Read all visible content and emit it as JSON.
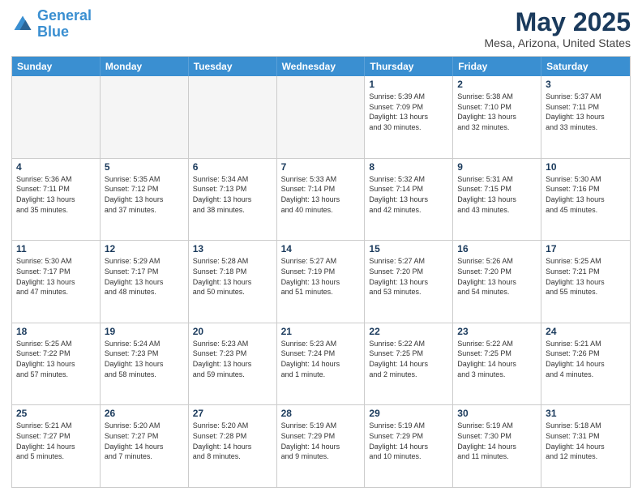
{
  "header": {
    "logo_line1": "General",
    "logo_line2": "Blue",
    "title": "May 2025",
    "subtitle": "Mesa, Arizona, United States"
  },
  "days_of_week": [
    "Sunday",
    "Monday",
    "Tuesday",
    "Wednesday",
    "Thursday",
    "Friday",
    "Saturday"
  ],
  "weeks": [
    [
      {
        "num": "",
        "info": ""
      },
      {
        "num": "",
        "info": ""
      },
      {
        "num": "",
        "info": ""
      },
      {
        "num": "",
        "info": ""
      },
      {
        "num": "1",
        "info": "Sunrise: 5:39 AM\nSunset: 7:09 PM\nDaylight: 13 hours\nand 30 minutes."
      },
      {
        "num": "2",
        "info": "Sunrise: 5:38 AM\nSunset: 7:10 PM\nDaylight: 13 hours\nand 32 minutes."
      },
      {
        "num": "3",
        "info": "Sunrise: 5:37 AM\nSunset: 7:11 PM\nDaylight: 13 hours\nand 33 minutes."
      }
    ],
    [
      {
        "num": "4",
        "info": "Sunrise: 5:36 AM\nSunset: 7:11 PM\nDaylight: 13 hours\nand 35 minutes."
      },
      {
        "num": "5",
        "info": "Sunrise: 5:35 AM\nSunset: 7:12 PM\nDaylight: 13 hours\nand 37 minutes."
      },
      {
        "num": "6",
        "info": "Sunrise: 5:34 AM\nSunset: 7:13 PM\nDaylight: 13 hours\nand 38 minutes."
      },
      {
        "num": "7",
        "info": "Sunrise: 5:33 AM\nSunset: 7:14 PM\nDaylight: 13 hours\nand 40 minutes."
      },
      {
        "num": "8",
        "info": "Sunrise: 5:32 AM\nSunset: 7:14 PM\nDaylight: 13 hours\nand 42 minutes."
      },
      {
        "num": "9",
        "info": "Sunrise: 5:31 AM\nSunset: 7:15 PM\nDaylight: 13 hours\nand 43 minutes."
      },
      {
        "num": "10",
        "info": "Sunrise: 5:30 AM\nSunset: 7:16 PM\nDaylight: 13 hours\nand 45 minutes."
      }
    ],
    [
      {
        "num": "11",
        "info": "Sunrise: 5:30 AM\nSunset: 7:17 PM\nDaylight: 13 hours\nand 47 minutes."
      },
      {
        "num": "12",
        "info": "Sunrise: 5:29 AM\nSunset: 7:17 PM\nDaylight: 13 hours\nand 48 minutes."
      },
      {
        "num": "13",
        "info": "Sunrise: 5:28 AM\nSunset: 7:18 PM\nDaylight: 13 hours\nand 50 minutes."
      },
      {
        "num": "14",
        "info": "Sunrise: 5:27 AM\nSunset: 7:19 PM\nDaylight: 13 hours\nand 51 minutes."
      },
      {
        "num": "15",
        "info": "Sunrise: 5:27 AM\nSunset: 7:20 PM\nDaylight: 13 hours\nand 53 minutes."
      },
      {
        "num": "16",
        "info": "Sunrise: 5:26 AM\nSunset: 7:20 PM\nDaylight: 13 hours\nand 54 minutes."
      },
      {
        "num": "17",
        "info": "Sunrise: 5:25 AM\nSunset: 7:21 PM\nDaylight: 13 hours\nand 55 minutes."
      }
    ],
    [
      {
        "num": "18",
        "info": "Sunrise: 5:25 AM\nSunset: 7:22 PM\nDaylight: 13 hours\nand 57 minutes."
      },
      {
        "num": "19",
        "info": "Sunrise: 5:24 AM\nSunset: 7:23 PM\nDaylight: 13 hours\nand 58 minutes."
      },
      {
        "num": "20",
        "info": "Sunrise: 5:23 AM\nSunset: 7:23 PM\nDaylight: 13 hours\nand 59 minutes."
      },
      {
        "num": "21",
        "info": "Sunrise: 5:23 AM\nSunset: 7:24 PM\nDaylight: 14 hours\nand 1 minute."
      },
      {
        "num": "22",
        "info": "Sunrise: 5:22 AM\nSunset: 7:25 PM\nDaylight: 14 hours\nand 2 minutes."
      },
      {
        "num": "23",
        "info": "Sunrise: 5:22 AM\nSunset: 7:25 PM\nDaylight: 14 hours\nand 3 minutes."
      },
      {
        "num": "24",
        "info": "Sunrise: 5:21 AM\nSunset: 7:26 PM\nDaylight: 14 hours\nand 4 minutes."
      }
    ],
    [
      {
        "num": "25",
        "info": "Sunrise: 5:21 AM\nSunset: 7:27 PM\nDaylight: 14 hours\nand 5 minutes."
      },
      {
        "num": "26",
        "info": "Sunrise: 5:20 AM\nSunset: 7:27 PM\nDaylight: 14 hours\nand 7 minutes."
      },
      {
        "num": "27",
        "info": "Sunrise: 5:20 AM\nSunset: 7:28 PM\nDaylight: 14 hours\nand 8 minutes."
      },
      {
        "num": "28",
        "info": "Sunrise: 5:19 AM\nSunset: 7:29 PM\nDaylight: 14 hours\nand 9 minutes."
      },
      {
        "num": "29",
        "info": "Sunrise: 5:19 AM\nSunset: 7:29 PM\nDaylight: 14 hours\nand 10 minutes."
      },
      {
        "num": "30",
        "info": "Sunrise: 5:19 AM\nSunset: 7:30 PM\nDaylight: 14 hours\nand 11 minutes."
      },
      {
        "num": "31",
        "info": "Sunrise: 5:18 AM\nSunset: 7:31 PM\nDaylight: 14 hours\nand 12 minutes."
      }
    ]
  ]
}
